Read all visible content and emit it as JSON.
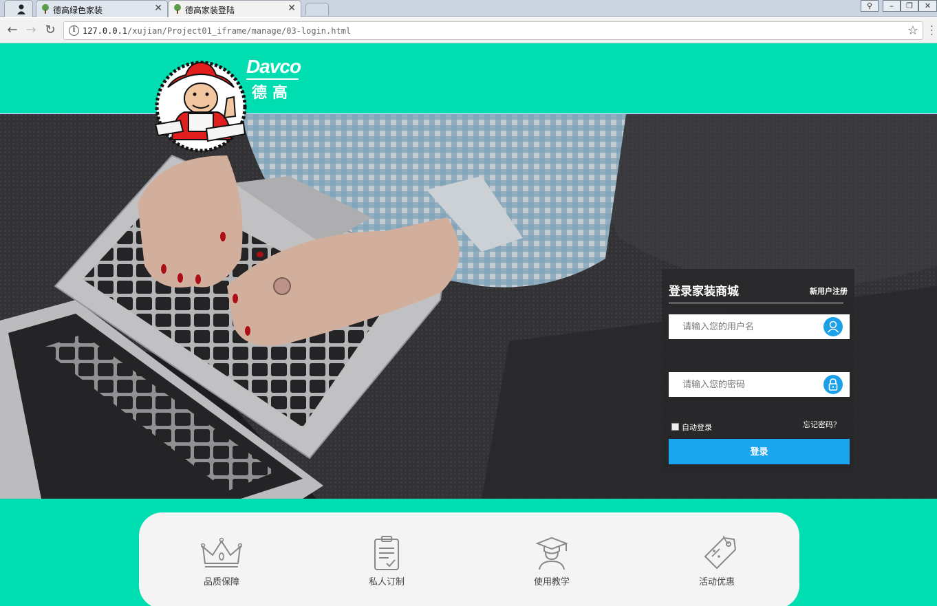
{
  "browser": {
    "tabs": [
      {
        "label": "德高绿色家装",
        "active": false
      },
      {
        "label": "德高家装登陆",
        "active": true
      }
    ],
    "url_host": "127.0.0.1",
    "url_path": "/xujian/Project01_iframe/manage/03-login.html"
  },
  "brand": {
    "name_en": "Davco",
    "name_cn": "德高",
    "accent_color": "#00ddb0",
    "button_color": "#1aa6ee"
  },
  "login": {
    "title": "登录家装商城",
    "register_link": "新用户注册",
    "username_placeholder": "请输入您的用户名",
    "password_placeholder": "请输入您的密码",
    "remember_label": "自动登录",
    "forgot_link": "忘记密码？",
    "submit_label": "登录"
  },
  "features": [
    {
      "label": "品质保障",
      "icon": "crown-icon"
    },
    {
      "label": "私人订制",
      "icon": "clipboard-icon"
    },
    {
      "label": "使用教学",
      "icon": "graduate-icon"
    },
    {
      "label": "活动优惠",
      "icon": "tag-icon"
    }
  ]
}
